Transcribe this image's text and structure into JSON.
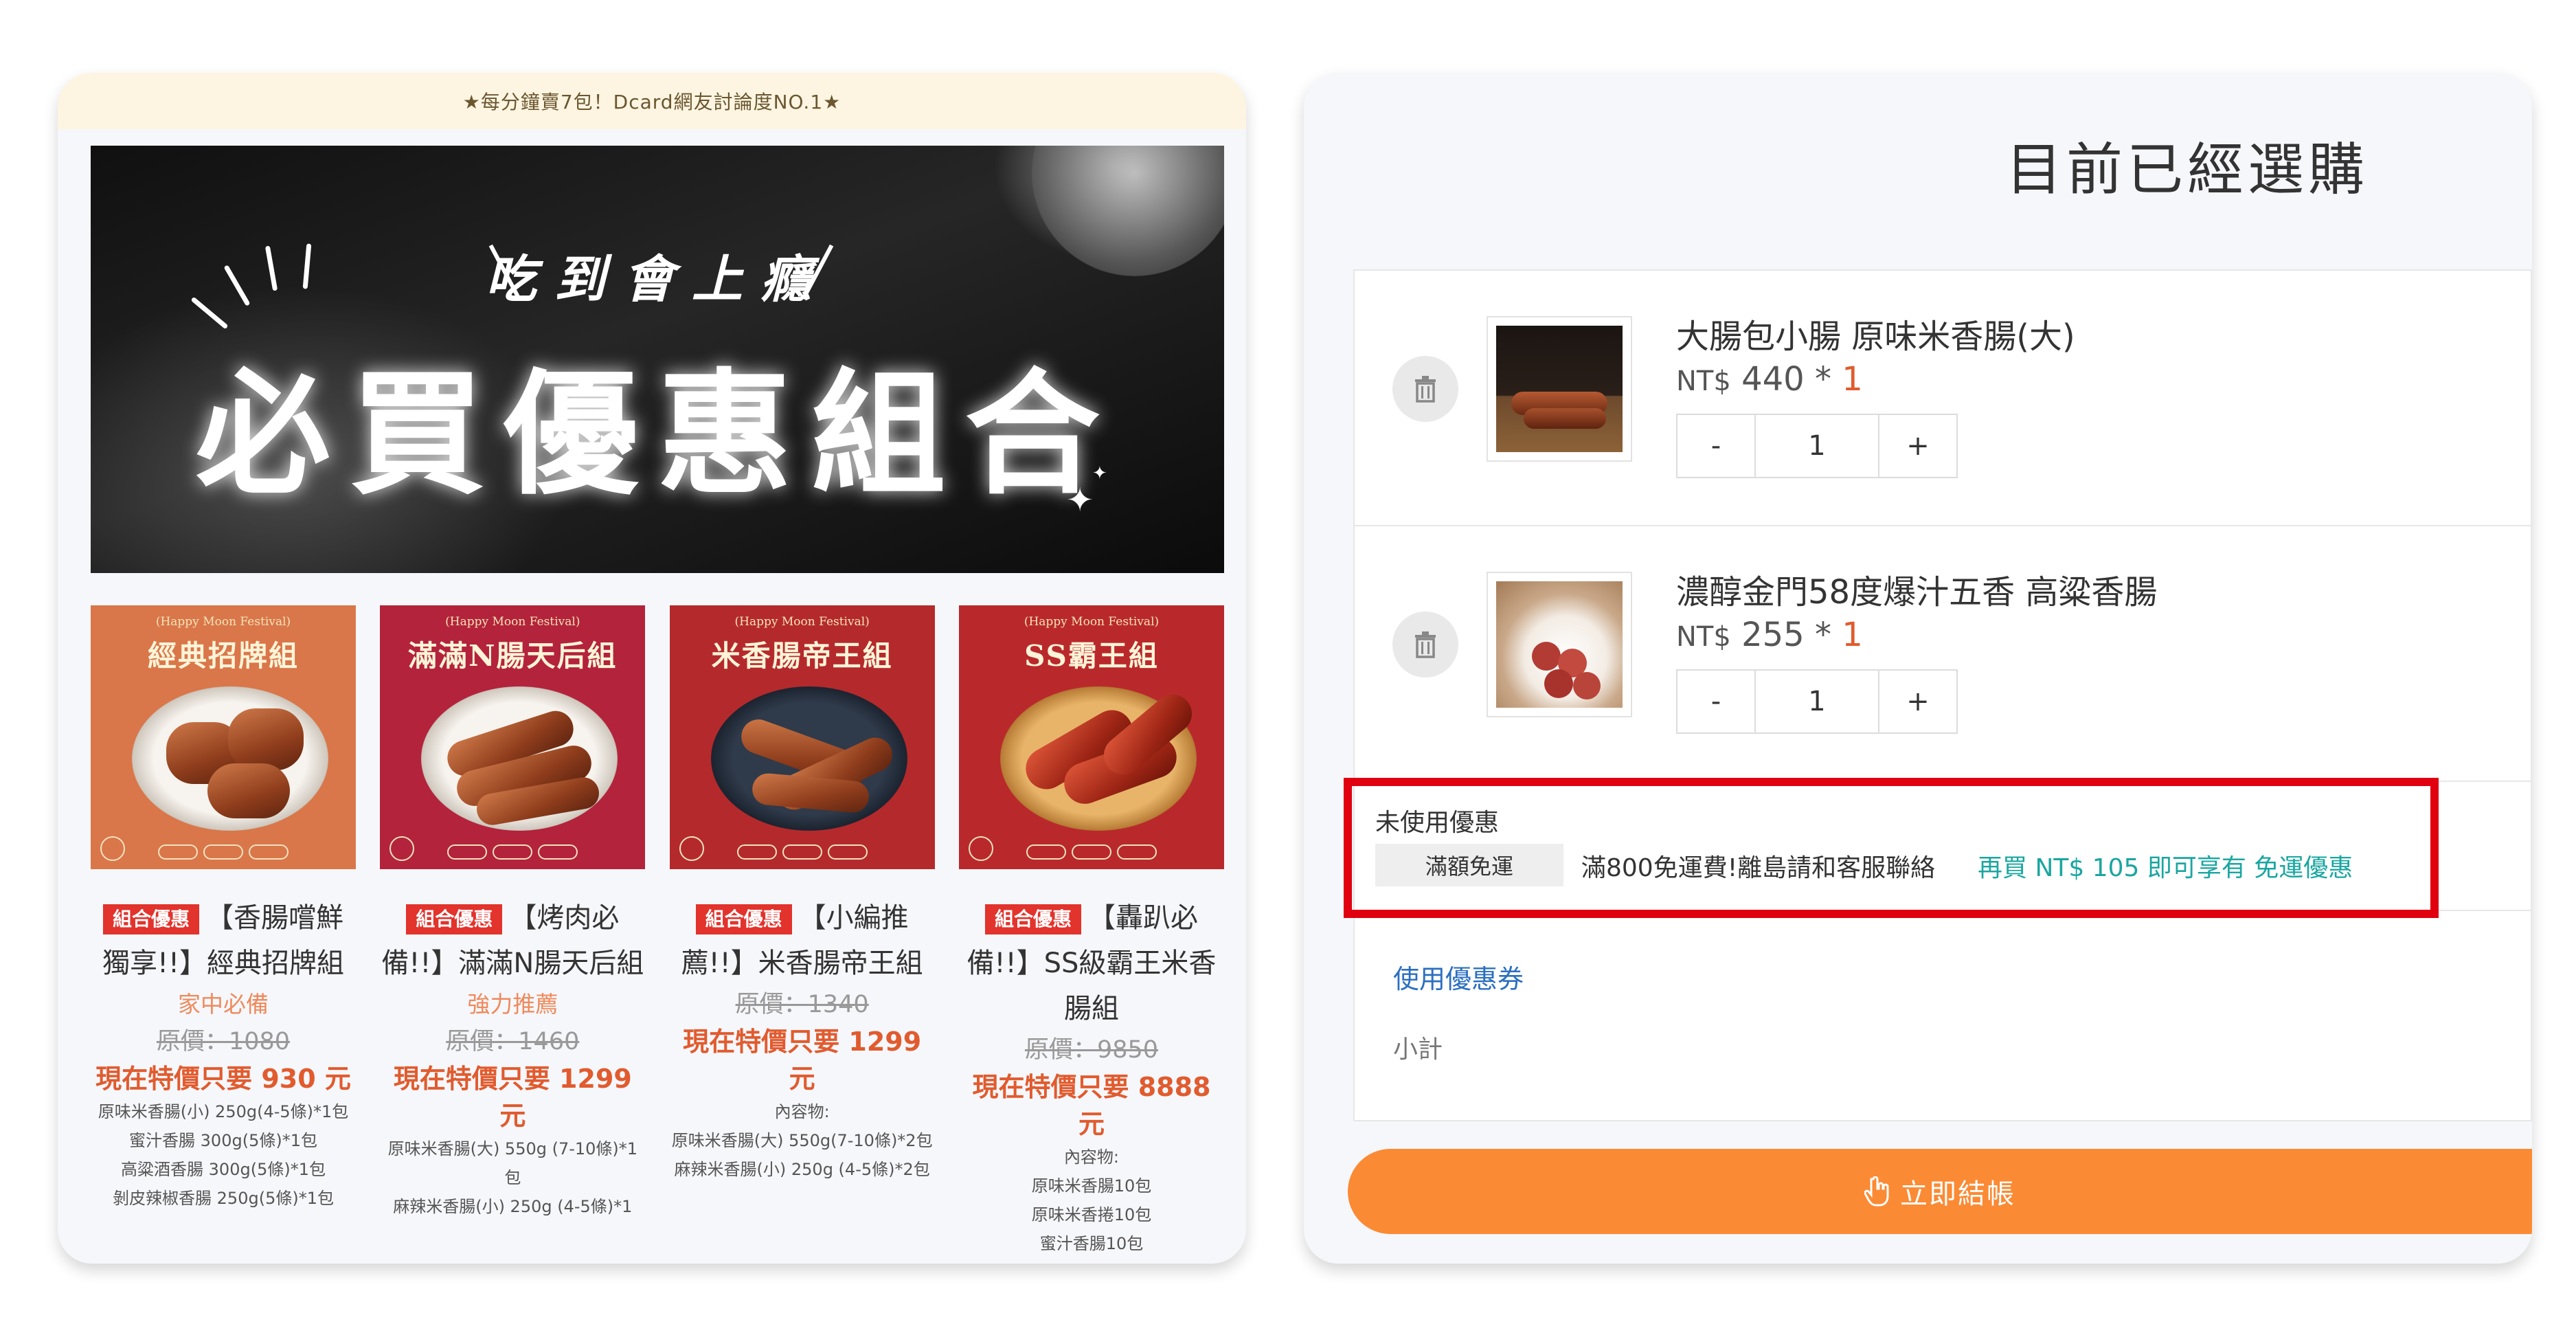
{
  "left": {
    "announcement": "★每分鐘賣7包！Dcard網友討論度NO.1★",
    "banner": {
      "subtitle": "吃到會上癮",
      "title": "必買優惠組合"
    },
    "products": [
      {
        "badge": "組合優惠",
        "img_title": "經典招牌組",
        "img_festival": "(Happy Moon Festival)",
        "name": "【香腸嚐鮮獨享!!】經典招牌組",
        "tagline": "家中必備",
        "original_price": "原價：1080",
        "sale_price": "現在特價只要 930 元",
        "contents": [
          "原味米香腸(小) 250g(4-5條)*1包",
          "蜜汁香腸 300g(5條)*1包",
          "高粱酒香腸 300g(5條)*1包",
          "剝皮辣椒香腸 250g(5條)*1包"
        ],
        "img_bg": "#d9774a"
      },
      {
        "badge": "組合優惠",
        "img_title": "滿滿N腸天后組",
        "img_festival": "(Happy Moon Festival)",
        "name": "【烤肉必備!!】滿滿N腸天后組",
        "tagline": "強力推薦",
        "original_price": "原價：1460",
        "sale_price": "現在特價只要 1299 元",
        "contents": [
          "原味米香腸(大) 550g (7-10條)*1包",
          "麻辣米香腸(小) 250g (4-5條)*1"
        ],
        "img_bg": "#b3233b"
      },
      {
        "badge": "組合優惠",
        "img_title": "米香腸帝王組",
        "img_festival": "(Happy Moon Festival)",
        "name": "【小編推薦!!】米香腸帝王組",
        "tagline": "",
        "original_price": "原價：1340",
        "sale_price": "現在特價只要 1299 元",
        "contents": [
          "內容物:",
          "原味米香腸(大) 550g(7-10條)*2包",
          "麻辣米香腸(小) 250g (4-5條)*2包"
        ],
        "img_bg": "#b42a2c"
      },
      {
        "badge": "組合優惠",
        "img_title": "SS霸王組",
        "img_festival": "(Happy Moon Festival)",
        "name": "【轟趴必備!!】SS級霸王米香腸組",
        "tagline": "",
        "original_price": "原價：9850",
        "sale_price": "現在特價只要 8888 元",
        "contents": [
          "內容物:",
          "原味米香腸10包",
          "原味米香捲10包",
          "蜜汁香腸10包"
        ],
        "img_bg": "#b9292b"
      }
    ]
  },
  "cart": {
    "title": "目前已經選購",
    "items": [
      {
        "name": "大腸包小腸 原味米香腸(大)",
        "currency": "NT$",
        "price": "440",
        "times": "*",
        "qty_display": "1",
        "quantity": "1",
        "minus": "-",
        "plus": "+"
      },
      {
        "name": "濃醇金門58度爆汁五香 高粱香腸",
        "currency": "NT$",
        "price": "255",
        "times": "*",
        "qty_display": "1",
        "quantity": "1",
        "minus": "-",
        "plus": "+"
      }
    ],
    "promo": {
      "label": "未使用優惠",
      "tag": "滿額免運",
      "description": "滿800免運費!離島請和客服聯絡",
      "hint": "再買 NT$ 105 即可享有 免運優惠"
    },
    "coupon_link": "使用優惠券",
    "subtotal_label": "小計",
    "checkout_label": "立即結帳",
    "colors": {
      "accent": "#fb8a34",
      "price_red": "#e15b2e",
      "hint_teal": "#1aa6a0",
      "highlight_red": "#e0000f"
    }
  }
}
